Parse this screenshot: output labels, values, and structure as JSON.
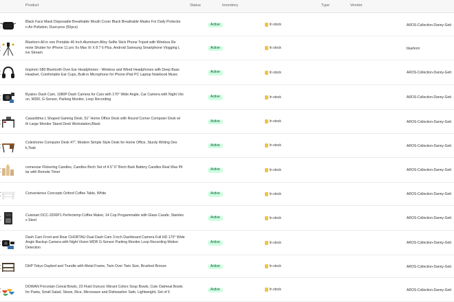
{
  "table": {
    "headers": {
      "product": "Product",
      "status": "Status",
      "inventory": "Inventory",
      "type": "Type",
      "vendor": "Vendor"
    },
    "rows": [
      {
        "title_lines": [
          "Black Face Mask Disposable Breathable Mouth Cover Black Breathable Masks For Daily Protectio",
          "n Air Pollution, Dust-proo (50pcs)"
        ],
        "status": "Active",
        "inventory": "In stock",
        "type": "",
        "vendor": "AROS-Collection-Danny-Gett",
        "thumb_icon": "face-mask-icon"
      },
      {
        "title_lines": [
          "Bluehorn All in one Portable 40 Inch Aluminum Alloy Selfie Stick Phone Tripod with Wireless Re",
          "mote Shutter for iPhone 11 pro Xs Max Xr X 8 7 6 Plus, Android Samsung Smartphone Vlogging L",
          "ive Stream"
        ],
        "status": "Active",
        "inventory": "In stock",
        "type": "",
        "vendor": "bluehorn",
        "thumb_icon": "tripod-icon"
      },
      {
        "title_lines": [
          "bopmen S80 Bluetooth Over Ear Headphones - Wireless and Wired Headphones with Deep Bass",
          "Headset, Comfortable Ear Cups, Built-in Microphone for Phone iPad PC Laptop Notebook Music"
        ],
        "status": "Active",
        "inventory": "In stock",
        "type": "",
        "vendor": "AROS-Collection-Danny-Gett",
        "thumb_icon": "headphones-icon"
      },
      {
        "title_lines": [
          "Byakov Dash Cam, 1080P Dash Camera for Cars with 170° Wide Angle, Car Camera with Night Visi",
          "on, WDR, G-Sensor, Parking Monitor, Loop Recording"
        ],
        "status": "Active",
        "inventory": "In stock",
        "type": "",
        "vendor": "AROS-Collection-Danny-Gett",
        "thumb_icon": "dash-cam-icon"
      },
      {
        "title_lines": [
          "Casaottima L Shaped Gaming Desk, 51\" Home Office Desk with Round Corner Computer Desk wi",
          "th Large Monitor Stand Desk Workstation,Black"
        ],
        "status": "Active",
        "inventory": "In stock",
        "type": "",
        "vendor": "AROS-Collection-Danny-Gett",
        "thumb_icon": "gaming-desk-icon"
      },
      {
        "title_lines": [
          "Coleshome Computer Desk 47\", Modern Simple Style Desk for Home Office, Sturdy Writing Des",
          "k,Teak"
        ],
        "status": "Active",
        "inventory": "In stock",
        "type": "",
        "vendor": "AROS-Collection-Danny-Gett",
        "thumb_icon": "computer-desk-icon"
      },
      {
        "title_lines": [
          "comenzar Flickering Candles, Candles Birch Set of 4.5\" 6\" Birch Bark Battery Candles Real Wax Pil",
          "lar with Remote Timer"
        ],
        "status": "Active",
        "inventory": "In stock",
        "type": "",
        "vendor": "AROS-Collection-Danny-Gett",
        "thumb_icon": "candles-icon"
      },
      {
        "title_lines": [
          "Convenience Concepts Oxford Coffee Table, White"
        ],
        "status": "Active",
        "inventory": "In stock",
        "type": "",
        "vendor": "AROS-Collection-Danny-Gett",
        "thumb_icon": "coffee-table-icon"
      },
      {
        "title_lines": [
          "Cuisinart DCC-3200P1 Perfectemp Coffee Maker, 14 Cup Progammable with Glass Carafe, Stainles",
          "s Steel"
        ],
        "status": "Active",
        "inventory": "In stock",
        "type": "",
        "vendor": "AROS-Collection-Danny-Gett",
        "thumb_icon": "coffee-maker-icon"
      },
      {
        "title_lines": [
          "Dash Cam Front and Rear CHORTAU Dual Dash Cam 3 inch Dashboard Camera Full HD 170° Wide",
          "Angle Backup Camera with Night Vision WDR G-Sensor Parking Monitor Loop Recording Motion",
          "Detection"
        ],
        "status": "Active",
        "inventory": "In stock",
        "type": "",
        "vendor": "AROS-Collection-Danny-Gett",
        "thumb_icon": "dual-dash-cam-icon"
      },
      {
        "title_lines": [
          "DHP Tokyo Daybed and Trundle with Metal Frame, Twin Over Twin Size, Brushed Bronze"
        ],
        "status": "Active",
        "inventory": "In stock",
        "type": "",
        "vendor": "AROS-Collection-Danny-Gett",
        "thumb_icon": "daybed-icon"
      },
      {
        "title_lines": [
          "DOWAN Porcelain Cereal Bowls, 23 Fluid Ounces Vibrant Colors Soup Bowls, Cute Oatmeal Bowls",
          "for Pasta, Small Salad, Stews, Rice, Microwave and Dishwasher Safe, Lightweight, Set of 6"
        ],
        "status": "Active",
        "inventory": "In stock",
        "type": "",
        "vendor": "AROS-Collection-Danny-Gett",
        "thumb_icon": "bowls-icon"
      }
    ]
  }
}
